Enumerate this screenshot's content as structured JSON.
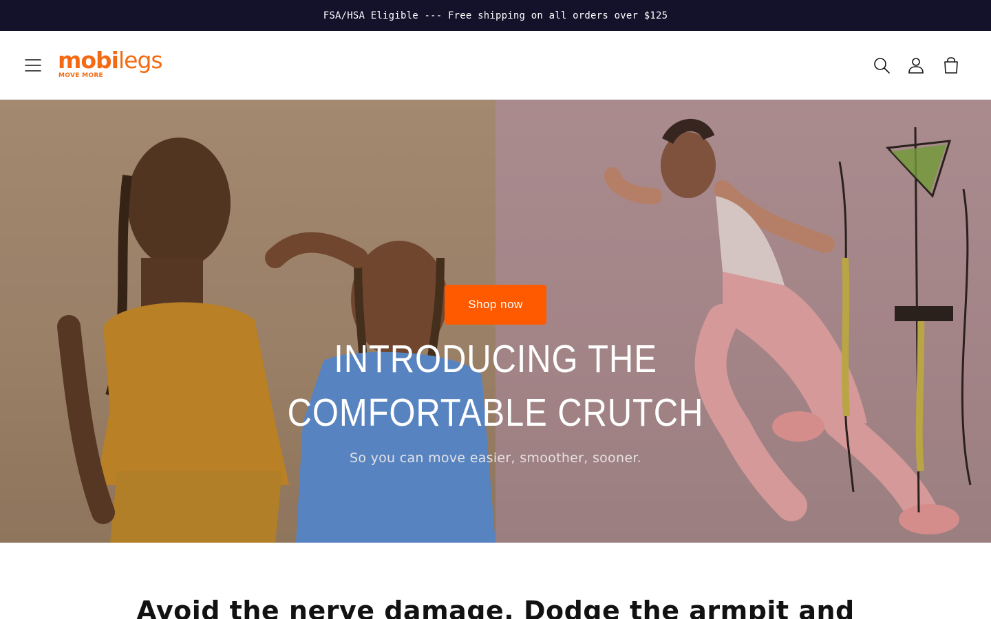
{
  "announcement": {
    "text": "FSA/HSA Eligible --- Free shipping on all orders over $125"
  },
  "header": {
    "logo": {
      "word_bold": "mobi",
      "word_light": "legs",
      "tagline": "MOVE MORE"
    },
    "icons": [
      "menu-icon",
      "search-icon",
      "account-icon",
      "cart-icon"
    ]
  },
  "hero": {
    "button_label": "Shop now",
    "title_line1": "INTRODUCING THE",
    "title_line2": "COMFORTABLE CRUTCH",
    "subtitle": "So you can move easier, smoother, sooner."
  },
  "section": {
    "heading": "Avoid the nerve damage. Dodge the armpit and"
  },
  "colors": {
    "announcement_bg": "#13122a",
    "brand_orange": "#f36a12",
    "button_orange": "#ff5a00",
    "text_dark": "#121212"
  }
}
